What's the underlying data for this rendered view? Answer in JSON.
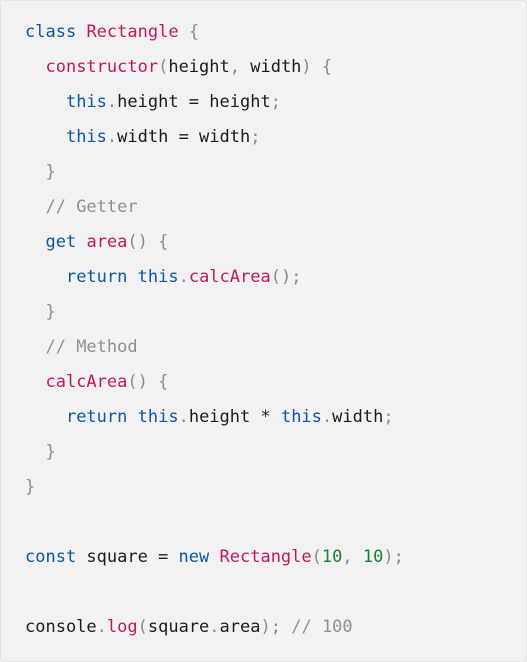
{
  "code": {
    "language": "javascript",
    "colors": {
      "background": "#f2f2f2",
      "keyword": "#0b57a0",
      "function": "#c2185b",
      "punctuation": "#8a8a8a",
      "comment": "#8f8f8f",
      "number": "#1b7f2a",
      "text": "#1b1b1b"
    },
    "lines": [
      [
        [
          "kw",
          "class"
        ],
        [
          "plain",
          " "
        ],
        [
          "fn",
          "Rectangle"
        ],
        [
          "plain",
          " "
        ],
        [
          "punc",
          "{"
        ]
      ],
      [
        [
          "plain",
          "  "
        ],
        [
          "fn",
          "constructor"
        ],
        [
          "punc",
          "("
        ],
        [
          "plain",
          "height"
        ],
        [
          "punc",
          ","
        ],
        [
          "plain",
          " width"
        ],
        [
          "punc",
          ")"
        ],
        [
          "plain",
          " "
        ],
        [
          "punc",
          "{"
        ]
      ],
      [
        [
          "plain",
          "    "
        ],
        [
          "kw",
          "this"
        ],
        [
          "punc",
          "."
        ],
        [
          "plain",
          "height = height"
        ],
        [
          "punc",
          ";"
        ]
      ],
      [
        [
          "plain",
          "    "
        ],
        [
          "kw",
          "this"
        ],
        [
          "punc",
          "."
        ],
        [
          "plain",
          "width = width"
        ],
        [
          "punc",
          ";"
        ]
      ],
      [
        [
          "plain",
          "  "
        ],
        [
          "punc",
          "}"
        ]
      ],
      [
        [
          "plain",
          "  "
        ],
        [
          "cmt",
          "// Getter"
        ]
      ],
      [
        [
          "plain",
          "  "
        ],
        [
          "kw",
          "get"
        ],
        [
          "plain",
          " "
        ],
        [
          "fn",
          "area"
        ],
        [
          "punc",
          "()"
        ],
        [
          "plain",
          " "
        ],
        [
          "punc",
          "{"
        ]
      ],
      [
        [
          "plain",
          "    "
        ],
        [
          "kw",
          "return"
        ],
        [
          "plain",
          " "
        ],
        [
          "kw",
          "this"
        ],
        [
          "punc",
          "."
        ],
        [
          "fn",
          "calcArea"
        ],
        [
          "punc",
          "();"
        ]
      ],
      [
        [
          "plain",
          "  "
        ],
        [
          "punc",
          "}"
        ]
      ],
      [
        [
          "plain",
          "  "
        ],
        [
          "cmt",
          "// Method"
        ]
      ],
      [
        [
          "plain",
          "  "
        ],
        [
          "fn",
          "calcArea"
        ],
        [
          "punc",
          "()"
        ],
        [
          "plain",
          " "
        ],
        [
          "punc",
          "{"
        ]
      ],
      [
        [
          "plain",
          "    "
        ],
        [
          "kw",
          "return"
        ],
        [
          "plain",
          " "
        ],
        [
          "kw",
          "this"
        ],
        [
          "punc",
          "."
        ],
        [
          "plain",
          "height * "
        ],
        [
          "kw",
          "this"
        ],
        [
          "punc",
          "."
        ],
        [
          "plain",
          "width"
        ],
        [
          "punc",
          ";"
        ]
      ],
      [
        [
          "plain",
          "  "
        ],
        [
          "punc",
          "}"
        ]
      ],
      [
        [
          "punc",
          "}"
        ]
      ],
      [],
      [
        [
          "kw",
          "const"
        ],
        [
          "plain",
          " square = "
        ],
        [
          "kw",
          "new"
        ],
        [
          "plain",
          " "
        ],
        [
          "fn",
          "Rectangle"
        ],
        [
          "punc",
          "("
        ],
        [
          "num",
          "10"
        ],
        [
          "punc",
          ","
        ],
        [
          "plain",
          " "
        ],
        [
          "num",
          "10"
        ],
        [
          "punc",
          ");"
        ]
      ],
      [],
      [
        [
          "plain",
          "console"
        ],
        [
          "punc",
          "."
        ],
        [
          "fn",
          "log"
        ],
        [
          "punc",
          "("
        ],
        [
          "plain",
          "square"
        ],
        [
          "punc",
          "."
        ],
        [
          "plain",
          "area"
        ],
        [
          "punc",
          ");"
        ],
        [
          "plain",
          " "
        ],
        [
          "cmt",
          "// 100"
        ]
      ]
    ]
  }
}
